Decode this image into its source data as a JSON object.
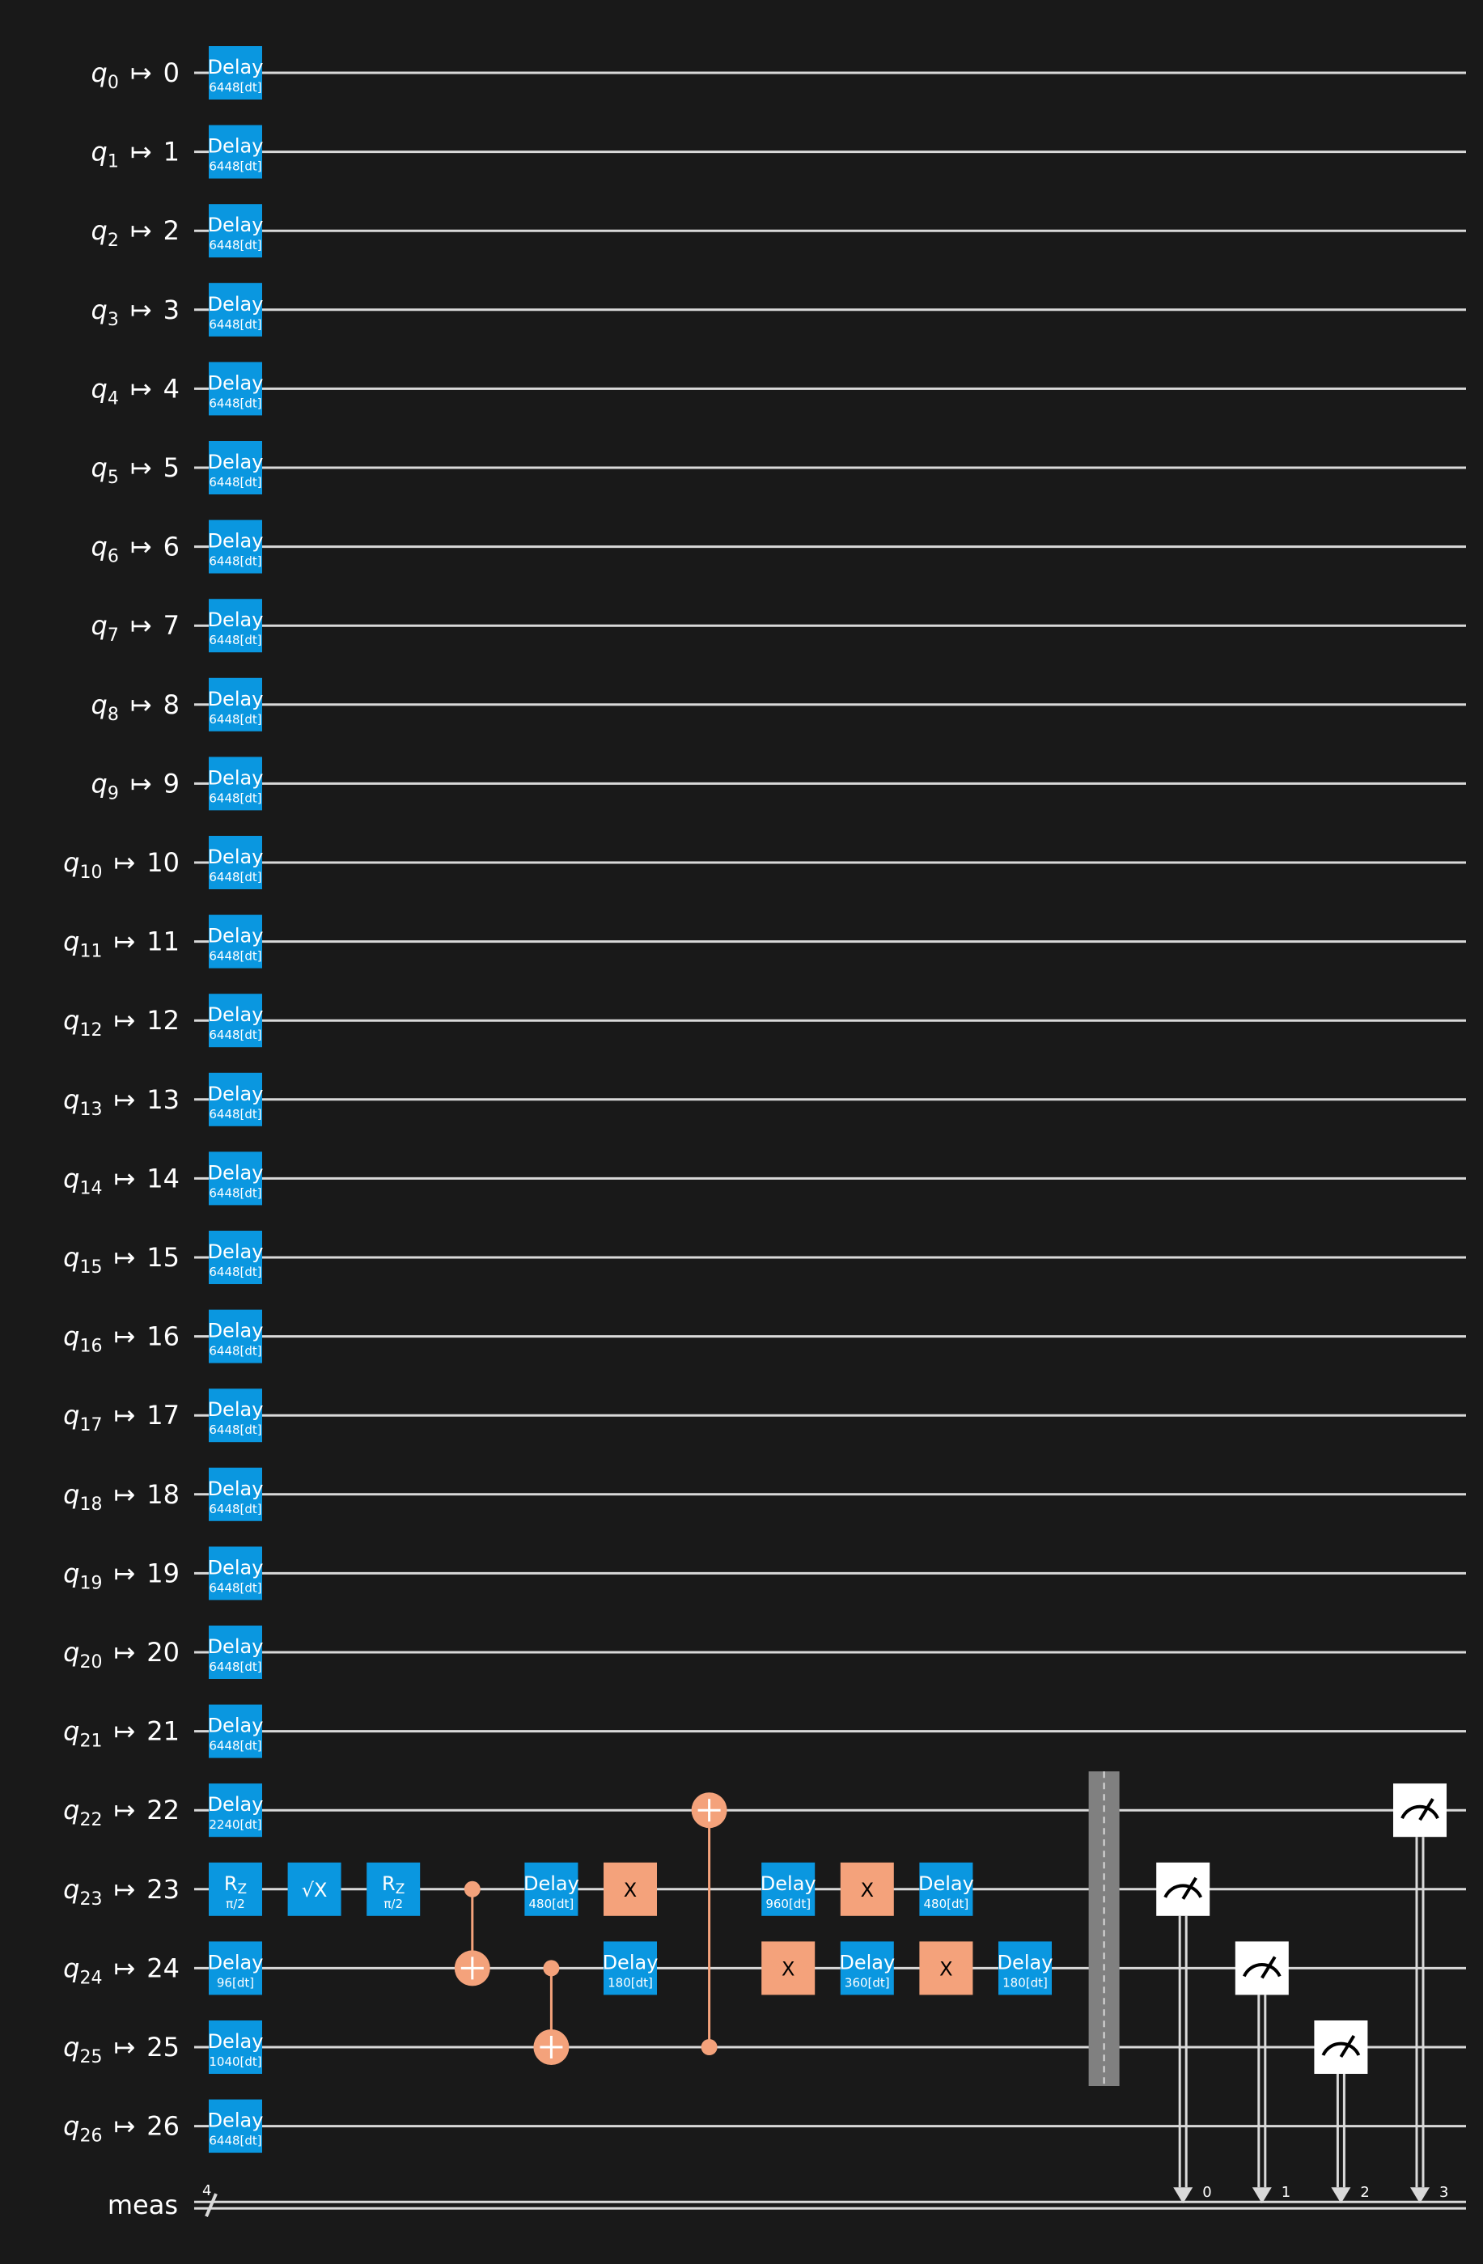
{
  "registers": [
    {
      "q": "q",
      "sub": "0",
      "phys": "0"
    },
    {
      "q": "q",
      "sub": "1",
      "phys": "1"
    },
    {
      "q": "q",
      "sub": "2",
      "phys": "2"
    },
    {
      "q": "q",
      "sub": "3",
      "phys": "3"
    },
    {
      "q": "q",
      "sub": "4",
      "phys": "4"
    },
    {
      "q": "q",
      "sub": "5",
      "phys": "5"
    },
    {
      "q": "q",
      "sub": "6",
      "phys": "6"
    },
    {
      "q": "q",
      "sub": "7",
      "phys": "7"
    },
    {
      "q": "q",
      "sub": "8",
      "phys": "8"
    },
    {
      "q": "q",
      "sub": "9",
      "phys": "9"
    },
    {
      "q": "q",
      "sub": "10",
      "phys": "10"
    },
    {
      "q": "q",
      "sub": "11",
      "phys": "11"
    },
    {
      "q": "q",
      "sub": "12",
      "phys": "12"
    },
    {
      "q": "q",
      "sub": "13",
      "phys": "13"
    },
    {
      "q": "q",
      "sub": "14",
      "phys": "14"
    },
    {
      "q": "q",
      "sub": "15",
      "phys": "15"
    },
    {
      "q": "q",
      "sub": "16",
      "phys": "16"
    },
    {
      "q": "q",
      "sub": "17",
      "phys": "17"
    },
    {
      "q": "q",
      "sub": "18",
      "phys": "18"
    },
    {
      "q": "q",
      "sub": "19",
      "phys": "19"
    },
    {
      "q": "q",
      "sub": "20",
      "phys": "20"
    },
    {
      "q": "q",
      "sub": "21",
      "phys": "21"
    },
    {
      "q": "q",
      "sub": "22",
      "phys": "22"
    },
    {
      "q": "q",
      "sub": "23",
      "phys": "23"
    },
    {
      "q": "q",
      "sub": "24",
      "phys": "24"
    },
    {
      "q": "q",
      "sub": "25",
      "phys": "25"
    },
    {
      "q": "q",
      "sub": "26",
      "phys": "26"
    }
  ],
  "mapsto_symbol": "↦",
  "classical": {
    "label": "meas",
    "width": "4",
    "bits": [
      "0",
      "1",
      "2",
      "3"
    ]
  },
  "colors": {
    "background": "#191919",
    "wire": "#d9d9d9",
    "delay_gate": "#0a97e0",
    "x_gate": "#f4a27b",
    "cx": "#f4a27b",
    "barrier": "#808080",
    "measure": "#ffffff"
  },
  "gates": [
    {
      "type": "delay",
      "qubit": 0,
      "col": 0,
      "label": "Delay",
      "param": "6448[dt]"
    },
    {
      "type": "delay",
      "qubit": 1,
      "col": 0,
      "label": "Delay",
      "param": "6448[dt]"
    },
    {
      "type": "delay",
      "qubit": 2,
      "col": 0,
      "label": "Delay",
      "param": "6448[dt]"
    },
    {
      "type": "delay",
      "qubit": 3,
      "col": 0,
      "label": "Delay",
      "param": "6448[dt]"
    },
    {
      "type": "delay",
      "qubit": 4,
      "col": 0,
      "label": "Delay",
      "param": "6448[dt]"
    },
    {
      "type": "delay",
      "qubit": 5,
      "col": 0,
      "label": "Delay",
      "param": "6448[dt]"
    },
    {
      "type": "delay",
      "qubit": 6,
      "col": 0,
      "label": "Delay",
      "param": "6448[dt]"
    },
    {
      "type": "delay",
      "qubit": 7,
      "col": 0,
      "label": "Delay",
      "param": "6448[dt]"
    },
    {
      "type": "delay",
      "qubit": 8,
      "col": 0,
      "label": "Delay",
      "param": "6448[dt]"
    },
    {
      "type": "delay",
      "qubit": 9,
      "col": 0,
      "label": "Delay",
      "param": "6448[dt]"
    },
    {
      "type": "delay",
      "qubit": 10,
      "col": 0,
      "label": "Delay",
      "param": "6448[dt]"
    },
    {
      "type": "delay",
      "qubit": 11,
      "col": 0,
      "label": "Delay",
      "param": "6448[dt]"
    },
    {
      "type": "delay",
      "qubit": 12,
      "col": 0,
      "label": "Delay",
      "param": "6448[dt]"
    },
    {
      "type": "delay",
      "qubit": 13,
      "col": 0,
      "label": "Delay",
      "param": "6448[dt]"
    },
    {
      "type": "delay",
      "qubit": 14,
      "col": 0,
      "label": "Delay",
      "param": "6448[dt]"
    },
    {
      "type": "delay",
      "qubit": 15,
      "col": 0,
      "label": "Delay",
      "param": "6448[dt]"
    },
    {
      "type": "delay",
      "qubit": 16,
      "col": 0,
      "label": "Delay",
      "param": "6448[dt]"
    },
    {
      "type": "delay",
      "qubit": 17,
      "col": 0,
      "label": "Delay",
      "param": "6448[dt]"
    },
    {
      "type": "delay",
      "qubit": 18,
      "col": 0,
      "label": "Delay",
      "param": "6448[dt]"
    },
    {
      "type": "delay",
      "qubit": 19,
      "col": 0,
      "label": "Delay",
      "param": "6448[dt]"
    },
    {
      "type": "delay",
      "qubit": 20,
      "col": 0,
      "label": "Delay",
      "param": "6448[dt]"
    },
    {
      "type": "delay",
      "qubit": 21,
      "col": 0,
      "label": "Delay",
      "param": "6448[dt]"
    },
    {
      "type": "delay",
      "qubit": 22,
      "col": 0,
      "label": "Delay",
      "param": "2240[dt]"
    },
    {
      "type": "rz",
      "qubit": 23,
      "col": 0,
      "label": "R",
      "label_sub": "Z",
      "param": "π/2"
    },
    {
      "type": "delay",
      "qubit": 24,
      "col": 0,
      "label": "Delay",
      "param": "96[dt]"
    },
    {
      "type": "delay",
      "qubit": 25,
      "col": 0,
      "label": "Delay",
      "param": "1040[dt]"
    },
    {
      "type": "delay",
      "qubit": 26,
      "col": 0,
      "label": "Delay",
      "param": "6448[dt]"
    },
    {
      "type": "sx",
      "qubit": 23,
      "col": 1,
      "label": "√X"
    },
    {
      "type": "rz",
      "qubit": 23,
      "col": 2,
      "label": "R",
      "label_sub": "Z",
      "param": "π/2"
    },
    {
      "type": "cx",
      "control": 23,
      "target": 24,
      "col": 3
    },
    {
      "type": "cx",
      "control": 24,
      "target": 25,
      "col": 4
    },
    {
      "type": "delay",
      "qubit": 23,
      "col": 4,
      "label": "Delay",
      "param": "480[dt]"
    },
    {
      "type": "x",
      "qubit": 23,
      "col": 5,
      "label": "X"
    },
    {
      "type": "delay",
      "qubit": 24,
      "col": 5,
      "label": "Delay",
      "param": "180[dt]"
    },
    {
      "type": "cx",
      "control": 25,
      "target": 22,
      "col": 6
    },
    {
      "type": "delay",
      "qubit": 23,
      "col": 7,
      "label": "Delay",
      "param": "960[dt]"
    },
    {
      "type": "x",
      "qubit": 24,
      "col": 7,
      "label": "X"
    },
    {
      "type": "x",
      "qubit": 23,
      "col": 8,
      "label": "X"
    },
    {
      "type": "delay",
      "qubit": 24,
      "col": 8,
      "label": "Delay",
      "param": "360[dt]"
    },
    {
      "type": "delay",
      "qubit": 23,
      "col": 9,
      "label": "Delay",
      "param": "480[dt]"
    },
    {
      "type": "x",
      "qubit": 24,
      "col": 9,
      "label": "X"
    },
    {
      "type": "delay",
      "qubit": 24,
      "col": 10,
      "label": "Delay",
      "param": "180[dt]"
    },
    {
      "type": "barrier",
      "from": 22,
      "to": 25,
      "col": 11
    },
    {
      "type": "measure",
      "qubit": 23,
      "cbit": 0,
      "col": 12
    },
    {
      "type": "measure",
      "qubit": 24,
      "cbit": 1,
      "col": 13
    },
    {
      "type": "measure",
      "qubit": 25,
      "cbit": 2,
      "col": 14
    },
    {
      "type": "measure",
      "qubit": 22,
      "cbit": 3,
      "col": 15
    }
  ]
}
